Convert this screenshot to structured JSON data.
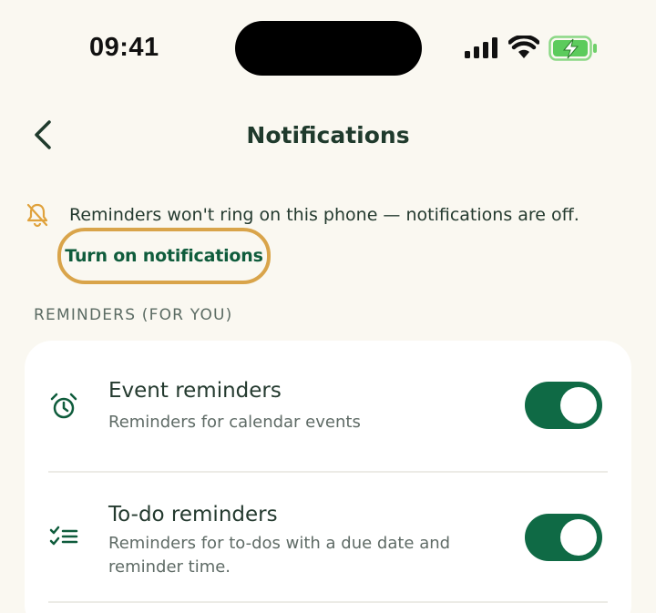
{
  "status_bar": {
    "time": "09:41"
  },
  "header": {
    "title": "Notifications"
  },
  "warning": {
    "text": "Reminders won't ring on this phone — notifications are off.",
    "action_label": "Turn on notifications"
  },
  "section": {
    "title": "REMINDERS (FOR YOU)"
  },
  "reminders": [
    {
      "title": "Event reminders",
      "subtitle": "Reminders for calendar events",
      "icon": "alarm-clock-icon",
      "enabled": true
    },
    {
      "title": "To-do reminders",
      "subtitle": "Reminders for to-dos with a due date and reminder time.",
      "icon": "checklist-icon",
      "enabled": true
    }
  ],
  "colors": {
    "background": "#faf8f1",
    "accent_green": "#0f6a45",
    "highlight_ring": "#d9a44a",
    "warning_icon": "#e0a23c"
  }
}
